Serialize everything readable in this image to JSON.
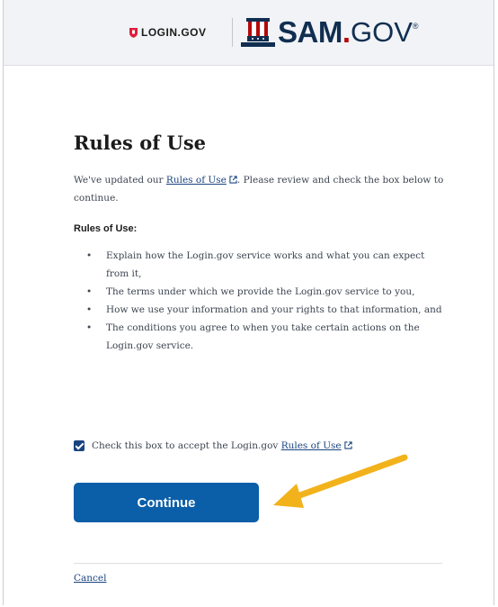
{
  "header": {
    "login_logo_text": "LOGIN.GOV",
    "sam_logo": {
      "main": "SAM",
      "dot": ".",
      "suffix": "GOV",
      "tm": "®"
    }
  },
  "page": {
    "title": "Rules of Use",
    "intro_before": "We've updated our ",
    "intro_link": "Rules of Use",
    "intro_after": ". Please review and check the box below to continue.",
    "rules_heading": "Rules of Use:",
    "rules": [
      "Explain how the Login.gov service works and what you can expect from it,",
      "The terms under which we provide the Login.gov service to you,",
      "How we use your information and your rights to that information, and",
      "The conditions you agree to when you take certain actions on the Login.gov service."
    ]
  },
  "acceptance": {
    "checked": true,
    "label_before": "Check this box to accept the Login.gov ",
    "link": "Rules of Use"
  },
  "continue_label": "Continue",
  "cancel_label": "Cancel",
  "colors": {
    "primary_button": "#0b5ea8",
    "link": "#1a4480",
    "arrow": "#f2b21b",
    "brand_red": "#b50909",
    "brand_navy": "#112e51"
  },
  "icons": [
    "login-shield-icon",
    "uncle-sam-hat-icon",
    "external-link-icon",
    "checkbox-checked-icon",
    "arrow-pointer-icon"
  ]
}
